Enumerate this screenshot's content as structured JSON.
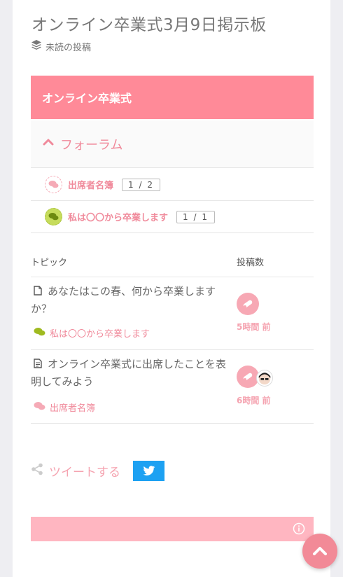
{
  "page": {
    "title": "オンライン卒業式3月9日掲示板",
    "unread_label": "未読の投稿"
  },
  "board": {
    "header": "オンライン卒業式",
    "forum_toggle_label": "フォーラム"
  },
  "subforums": [
    {
      "name": "出席者名簿",
      "pages": "1 / 2",
      "icon": "chat-bubbles-icon"
    },
    {
      "name": "私は〇〇から卒業します",
      "pages": "1 / 1",
      "icon": "chat-bubbles-icon"
    }
  ],
  "topic_table": {
    "col_topic": "トピック",
    "col_posts": "投稿数",
    "rows": [
      {
        "title": "あなたはこの春、何から卒業しますか？",
        "forum": "私は〇〇から卒業します",
        "time": "5時間 前"
      },
      {
        "title": "オンライン卒業式に出席したことを表明してみよう",
        "forum": "出席者名簿",
        "time": "6時間 前"
      }
    ]
  },
  "share": {
    "tweet_label": "ツイートする"
  },
  "colors": {
    "accent": "#ff8a98",
    "accent_text": "#f08a9b",
    "twitter": "#1da1f2",
    "footer": "#ffb6c1"
  }
}
